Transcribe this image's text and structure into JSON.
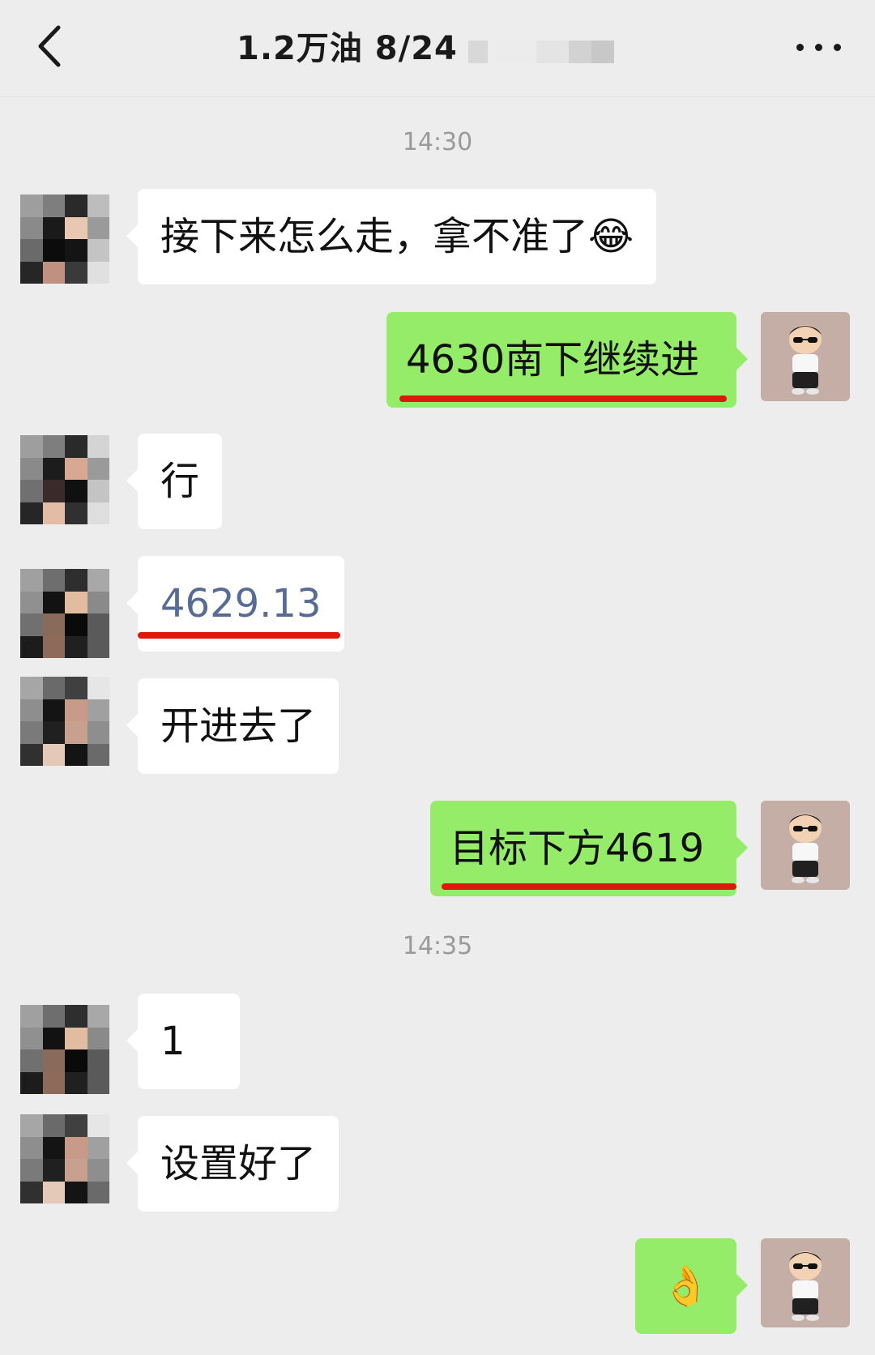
{
  "header": {
    "title": "1.2万油  8/24",
    "back_icon": "chevron-left-icon",
    "more_icon": "more-dots-icon"
  },
  "messages": {
    "time_1": "14:30",
    "m1": "接下来怎么走，拿不准了😂",
    "m2": "4630南下继续进",
    "m3": "行",
    "m4": "4629.13",
    "m5": "开进去了",
    "m6": "目标下方4619",
    "time_2": "14:35",
    "m7": "1",
    "m8": "设置好了",
    "m9": "👌"
  },
  "colors": {
    "background": "#ededed",
    "incoming_bubble": "#ffffff",
    "outgoing_bubble": "#95ec69",
    "link_text": "#576b95",
    "highlight_underline": "#e0180c"
  }
}
